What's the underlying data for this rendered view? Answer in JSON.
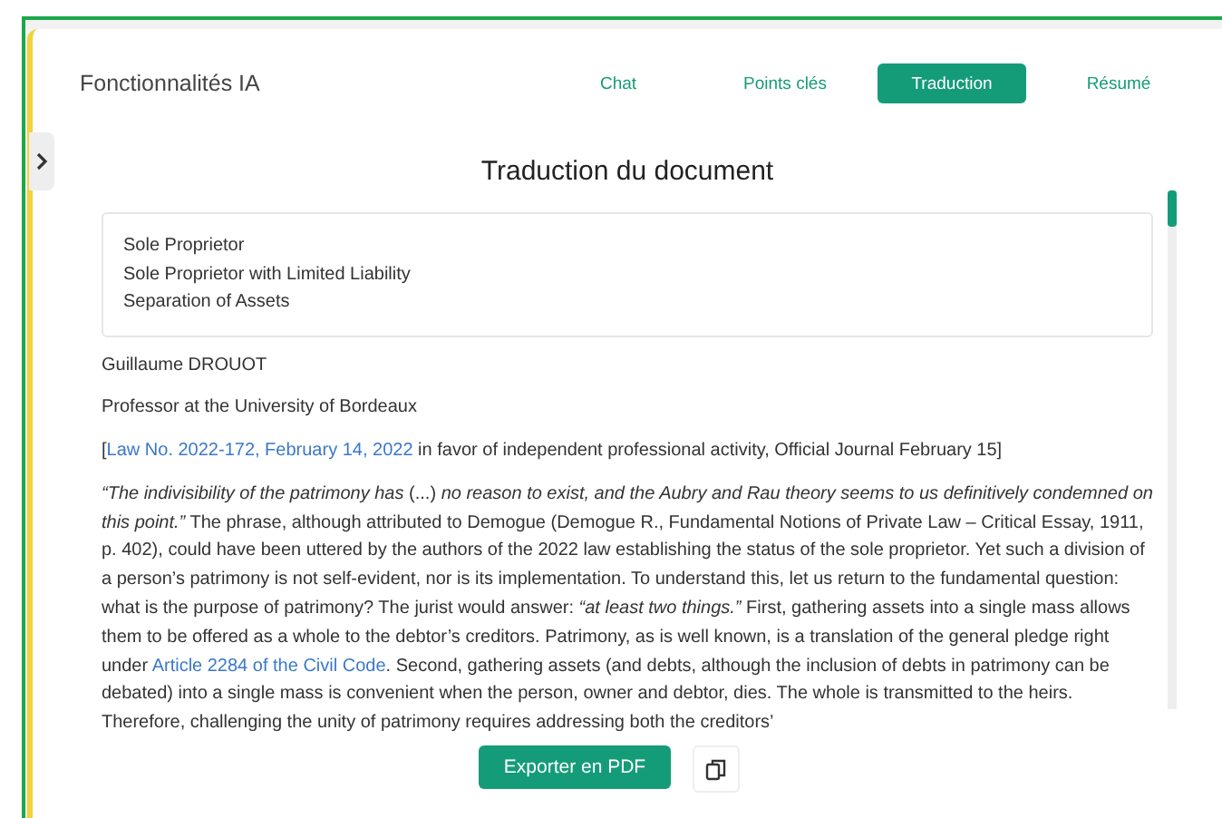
{
  "header": {
    "title": "Fonctionnalités IA"
  },
  "tabs": [
    {
      "label": "Chat",
      "selected": false
    },
    {
      "label": "Points clés",
      "selected": false
    },
    {
      "label": "Traduction",
      "selected": true
    },
    {
      "label": "Résumé",
      "selected": false
    }
  ],
  "heading": "Traduction du document",
  "summary_box": [
    "Sole Proprietor",
    "Sole Proprietor with Limited Liability",
    "Separation of Assets"
  ],
  "paragraphs": [
    [
      {
        "kind": "text",
        "text": "Guillaume DROUOT"
      }
    ],
    [
      {
        "kind": "text",
        "text": "Professor at the University of Bordeaux"
      }
    ],
    [
      {
        "kind": "text",
        "text": "["
      },
      {
        "kind": "link",
        "text": "Law No. 2022-172, February 14, 2022"
      },
      {
        "kind": "text",
        "text": " in favor of independent professional activity, Official Journal February 15]"
      }
    ],
    [
      {
        "kind": "text",
        "text": "*“The indivisibility of the patrimony has* (...) *no reason to exist, and the Aubry and Rau theory seems to us definitively condemned on this point.”* The phrase, although attributed to Demogue (Demogue R., Fundamental Notions of Private Law – Critical Essay, 1911, p. 402), could have been uttered by the authors of the 2022 law establishing the status of the sole proprietor. Yet such a division of a person’s patrimony is not self-evident, nor is its implementation. To understand this, let us return to the fundamental question: what is the purpose of patrimony? The jurist would answer: *“at least two things.”* First, gathering assets into a single mass allows them to be offered as a whole to the debtor’s creditors. Patrimony, as is well known, is a translation of the general pledge right under "
      },
      {
        "kind": "link",
        "text": "Article 2284 of the Civil Code"
      },
      {
        "kind": "text",
        "text": ". Second, gathering assets (and debts, although the inclusion of debts in patrimony can be debated) into a single mass is convenient when the person, owner and debtor, dies. The whole is transmitted to the heirs. Therefore, challenging the unity of patrimony requires addressing both the creditors’"
      }
    ]
  ],
  "export_button": "Exporter en PDF"
}
